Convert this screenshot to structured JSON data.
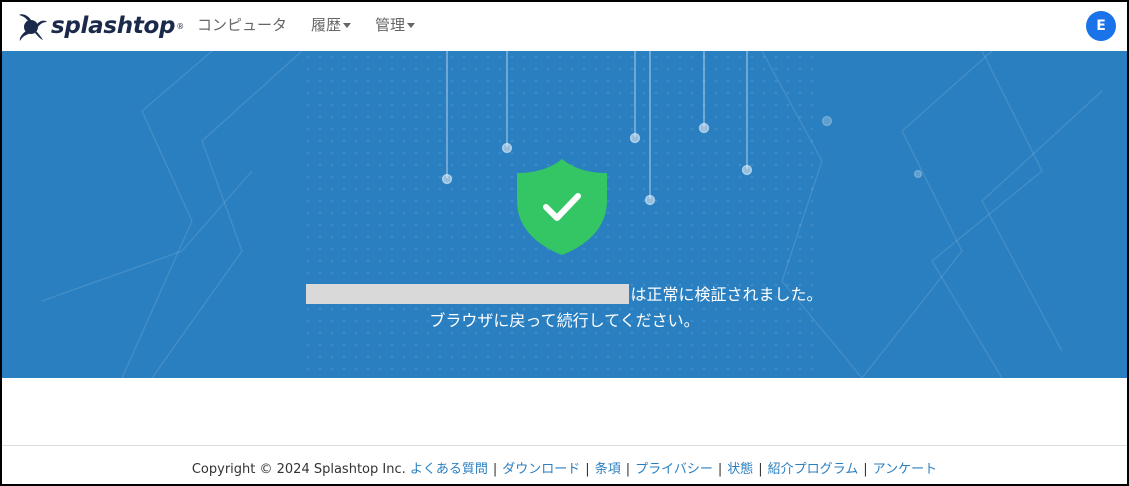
{
  "header": {
    "brand": "splashtop",
    "brand_mark": "®",
    "nav": [
      {
        "label": "コンピュータ",
        "has_caret": false
      },
      {
        "label": "履歴",
        "has_caret": true
      },
      {
        "label": "管理",
        "has_caret": true
      }
    ],
    "avatar_letter": "E"
  },
  "hero": {
    "icon": "shield-check-icon",
    "message_line1": "は正常に検証されました。",
    "message_line2": "ブラウザに戻って続行してください。",
    "colors": {
      "background": "#2a7fc0",
      "shield": "#34c565"
    }
  },
  "footer": {
    "copyright": "Copyright © 2024 Splashtop Inc.",
    "links": [
      "よくある質問",
      "ダウンロード",
      "条項",
      "プライバシー",
      "状態",
      "紹介プログラム",
      "アンケート"
    ],
    "separator": "|"
  }
}
